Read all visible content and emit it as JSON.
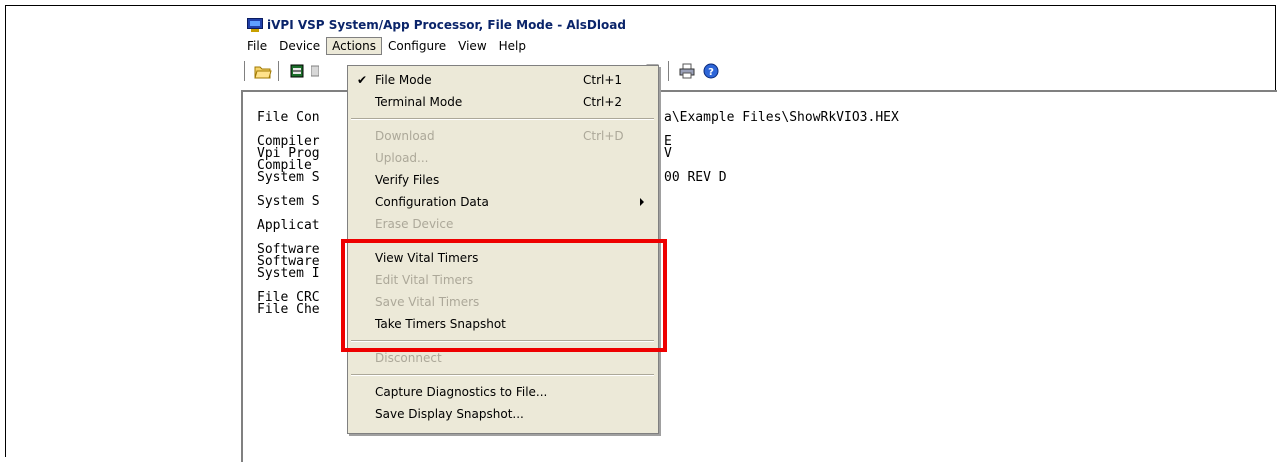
{
  "window": {
    "title": "iVPI VSP System/App Processor, File Mode - AlsDload"
  },
  "menubar": [
    "File",
    "Device",
    "Actions",
    "Configure",
    "View",
    "Help"
  ],
  "toolbar_icons": [
    "open-folder-icon",
    "chip-icon",
    "terminal-icon",
    "properties-icon",
    "printer-icon",
    "help-icon"
  ],
  "console": {
    "lines": [
      "File Con",
      "",
      "Compiler",
      "Vpi Prog",
      "Compile ",
      "System S",
      "",
      "System S",
      "",
      "Applicat",
      "",
      "Software",
      "Software",
      "System I",
      "",
      "File CRC",
      "File Che"
    ],
    "right_fragments": [
      {
        "row": 0,
        "text": "a\\Example Files\\ShowRkVIO3.HEX"
      },
      {
        "row": 2,
        "text": "E"
      },
      {
        "row": 3,
        "text": "V"
      },
      {
        "row": 5,
        "text": "00 REV D"
      }
    ]
  },
  "actions_menu": {
    "items": [
      {
        "label": "File Mode",
        "shortcut": "Ctrl+1",
        "checked": true,
        "enabled": true
      },
      {
        "label": "Terminal Mode",
        "shortcut": "Ctrl+2",
        "checked": false,
        "enabled": true
      },
      {
        "label": "Download",
        "shortcut": "Ctrl+D",
        "checked": false,
        "enabled": false
      },
      {
        "label": "Upload...",
        "shortcut": "",
        "checked": false,
        "enabled": false
      },
      {
        "label": "Verify Files",
        "shortcut": "",
        "checked": false,
        "enabled": true
      },
      {
        "label": "Configuration Data",
        "shortcut": "",
        "checked": false,
        "enabled": true,
        "submenu": true
      },
      {
        "label": "Erase Device",
        "shortcut": "",
        "checked": false,
        "enabled": false
      },
      {
        "label": "View Vital Timers",
        "shortcut": "",
        "checked": false,
        "enabled": true
      },
      {
        "label": "Edit Vital Timers",
        "shortcut": "",
        "checked": false,
        "enabled": false
      },
      {
        "label": "Save Vital Timers",
        "shortcut": "",
        "checked": false,
        "enabled": false
      },
      {
        "label": "Take Timers Snapshot",
        "shortcut": "",
        "checked": false,
        "enabled": true
      },
      {
        "label": "Disconnect",
        "shortcut": "",
        "checked": false,
        "enabled": false
      },
      {
        "label": "Capture Diagnostics to File...",
        "shortcut": "",
        "checked": false,
        "enabled": true
      },
      {
        "label": "Save Display Snapshot...",
        "shortcut": "",
        "checked": false,
        "enabled": true
      }
    ],
    "check_mark": "✔"
  },
  "colors": {
    "highlight_box": "#ee0000",
    "menu_bg": "#ece9d8",
    "disabled_text": "#aca899",
    "title_text": "#0a246a"
  }
}
